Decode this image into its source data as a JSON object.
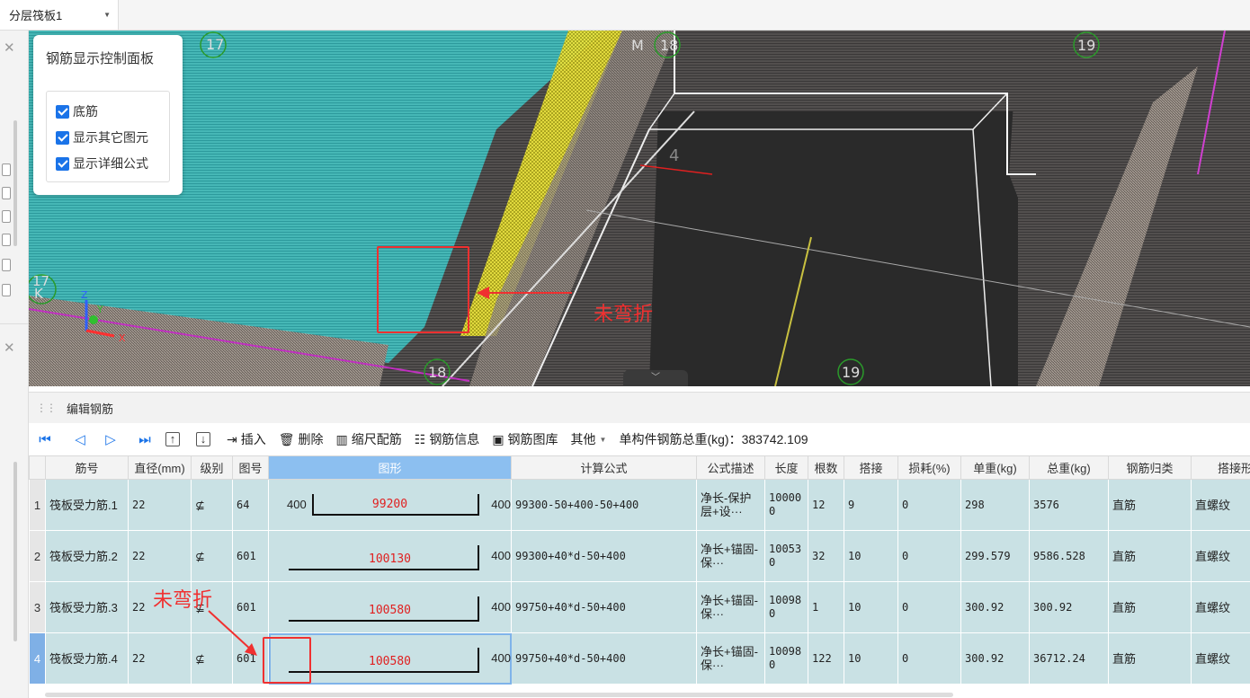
{
  "topbar": {
    "layer_select_value": "分层筏板1"
  },
  "viewport": {
    "axis_labels": [
      "17",
      "M",
      "18",
      "19",
      "17",
      "K",
      "18",
      "19"
    ],
    "grid_label_4": "4",
    "annotation": "未弯折"
  },
  "control_panel": {
    "title": "钢筋显示控制面板",
    "options": [
      {
        "label": "底筋",
        "checked": true
      },
      {
        "label": "显示其它图元",
        "checked": true
      },
      {
        "label": "显示详细公式",
        "checked": true
      }
    ]
  },
  "edit_panel": {
    "title": "编辑钢筋",
    "toolbar": {
      "insert": "插入",
      "delete": "删除",
      "scale_rebar": "缩尺配筋",
      "rebar_info": "钢筋信息",
      "rebar_library": "钢筋图库",
      "other": "其他",
      "total_weight_label": "单构件钢筋总重(kg)：383742.109"
    },
    "columns": [
      "筋号",
      "直径(mm)",
      "级别",
      "图号",
      "图形",
      "计算公式",
      "公式描述",
      "长度",
      "根数",
      "搭接",
      "损耗(%)",
      "单重(kg)",
      "总重(kg)",
      "钢筋归类",
      "搭接形"
    ],
    "rows": [
      {
        "n": "1",
        "name": "筏板受力筋.1",
        "dia": "22",
        "grade": "⊈",
        "fig": "64",
        "left": "400",
        "mid": "99200",
        "right": "400",
        "formula": "99300-50+400-50+400",
        "desc": "净长-保护层+设···",
        "len": "100000",
        "count": "12",
        "lap": "9",
        "loss": "0",
        "unit": "298",
        "total": "3576",
        "cls": "直筋",
        "laptype": "直螺纹"
      },
      {
        "n": "2",
        "name": "筏板受力筋.2",
        "dia": "22",
        "grade": "⊈",
        "fig": "601",
        "left": "",
        "mid": "100130",
        "right": "400",
        "formula": "99300+40*d-50+400",
        "desc": "净长+锚固-保···",
        "len": "100530",
        "count": "32",
        "lap": "10",
        "loss": "0",
        "unit": "299.579",
        "total": "9586.528",
        "cls": "直筋",
        "laptype": "直螺纹"
      },
      {
        "n": "3",
        "name": "筏板受力筋.3",
        "dia": "22",
        "grade": "⊈",
        "fig": "601",
        "left": "",
        "mid": "100580",
        "right": "400",
        "formula": "99750+40*d-50+400",
        "desc": "净长+锚固-保···",
        "len": "100980",
        "count": "1",
        "lap": "10",
        "loss": "0",
        "unit": "300.92",
        "total": "300.92",
        "cls": "直筋",
        "laptype": "直螺纹"
      },
      {
        "n": "4",
        "name": "筏板受力筋.4",
        "dia": "22",
        "grade": "⊈",
        "fig": "601",
        "left": "",
        "mid": "100580",
        "right": "400",
        "formula": "99750+40*d-50+400",
        "desc": "净长+锚固-保···",
        "len": "100980",
        "count": "122",
        "lap": "10",
        "loss": "0",
        "unit": "300.92",
        "total": "36712.24",
        "cls": "直筋",
        "laptype": "直螺纹"
      }
    ],
    "annotation": "未弯折"
  },
  "colors": {
    "accent": "#1a73e8",
    "annotation_red": "#f03030",
    "row_bg": "#c9e1e4",
    "rebar_cyan": "#3fb8b8",
    "rebar_yellow": "#d8d020"
  }
}
